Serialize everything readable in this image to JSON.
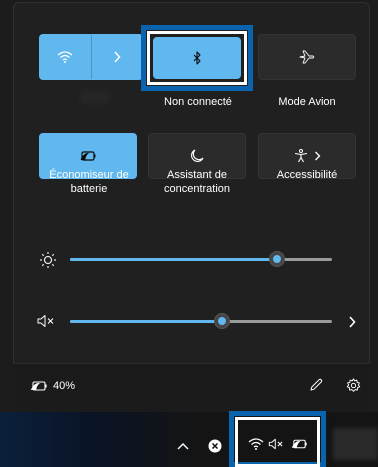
{
  "tiles": {
    "wifi": {
      "icon": "wifi-icon",
      "active": true
    },
    "bluetooth": {
      "icon": "bluetooth-icon",
      "label": "Non connecté",
      "active": true
    },
    "airplane": {
      "icon": "airplane-icon",
      "label": "Mode Avion",
      "active": false
    },
    "battery_saver": {
      "icon": "battery-saver-icon",
      "label_line1": "Économiseur de",
      "label_line2": "batterie",
      "active": true
    },
    "focus_assist": {
      "icon": "moon-icon",
      "label_line1": "Assistant de",
      "label_line2": "concentration",
      "active": false
    },
    "accessibility": {
      "icon": "accessibility-icon",
      "label": "Accessibilité",
      "active": false
    }
  },
  "sliders": {
    "brightness": {
      "icon": "brightness-icon",
      "value": 0.85
    },
    "volume": {
      "icon": "volume-muted-icon",
      "value": 0.6
    }
  },
  "footer": {
    "battery_icon": "battery-saver-icon",
    "battery_text": "40%",
    "edit_icon": "pencil-icon",
    "settings_icon": "gear-icon"
  },
  "taskbar": {
    "icons": [
      "chevron-up-icon",
      "close-circle-icon",
      "wifi-icon",
      "volume-muted-icon",
      "battery-saver-icon"
    ]
  },
  "colors": {
    "accent": "#60b8ee",
    "highlight_blue": "#0a63ad",
    "panel_bg": "#202020",
    "tile_bg": "#2b2b2b"
  }
}
